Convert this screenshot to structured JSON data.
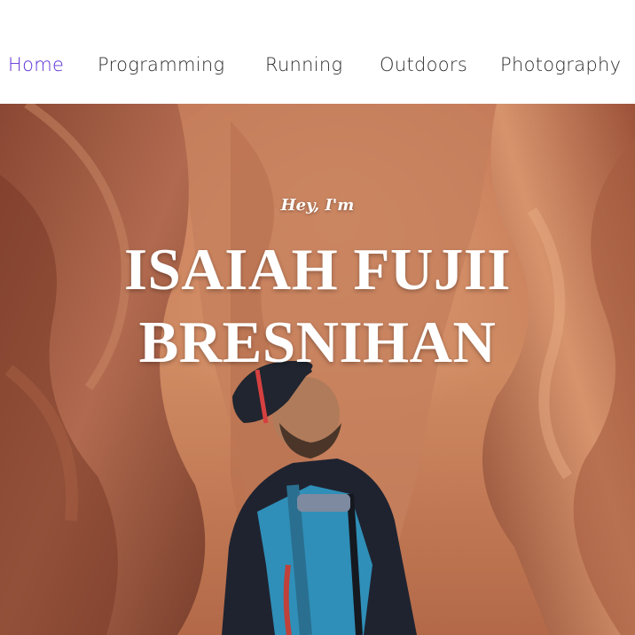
{
  "nav": {
    "items": [
      {
        "label": "Home",
        "active": true
      },
      {
        "label": "Programming",
        "active": false
      },
      {
        "label": "Running",
        "active": false
      },
      {
        "label": "Outdoors",
        "active": false
      },
      {
        "label": "Photography",
        "active": false
      }
    ],
    "active_color": "#5b2fd6",
    "text_color": "#2f2f2f"
  },
  "hero": {
    "greeting": "Hey, I'm",
    "name_line1": "ISAIAH FUJII",
    "name_line2": "BRESNIHAN",
    "image_subject": "hiker in a red slot canyon looking up"
  }
}
